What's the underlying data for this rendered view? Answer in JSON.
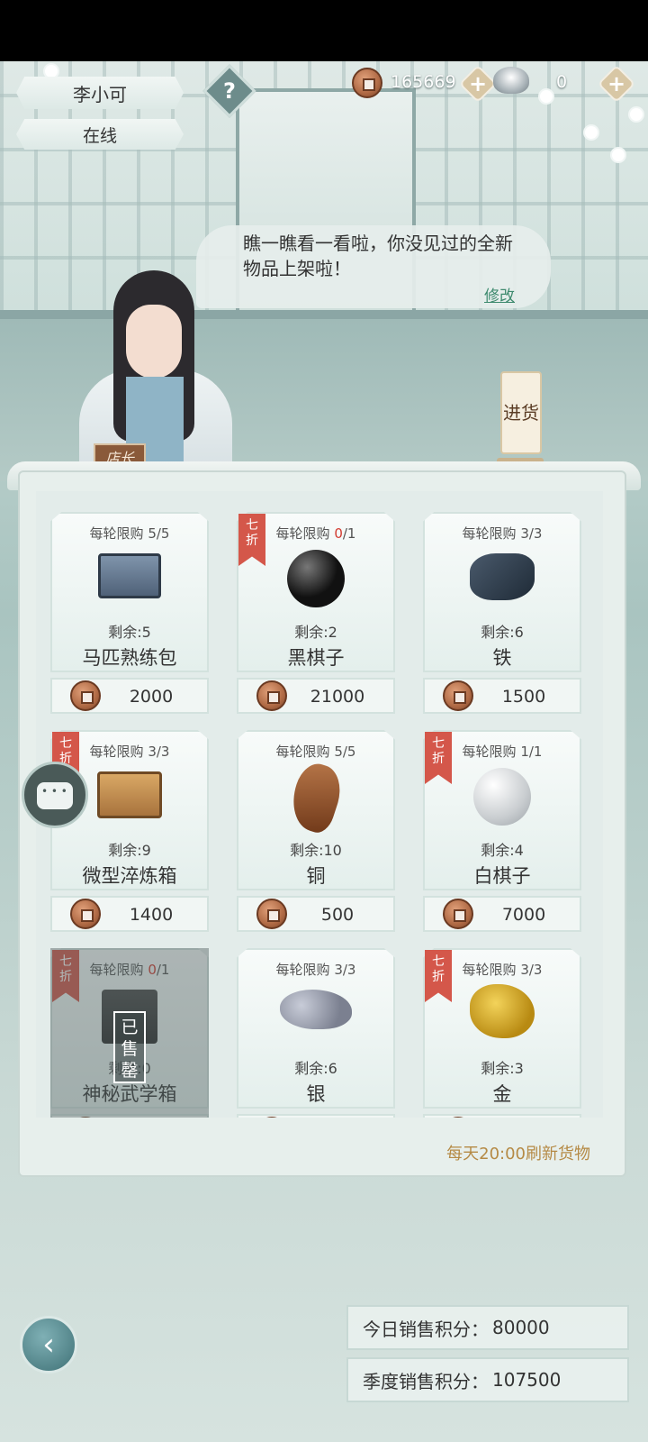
{
  "header": {
    "user_name": "李小可",
    "status": "在线",
    "help_icon": "question-icon",
    "copper_coins": "165669",
    "silver_ingots": "0"
  },
  "npc": {
    "speech": "瞧一瞧看一看啦，你没见过的全新物品上架啦！",
    "edit_label": "修改",
    "title_tag": "店长"
  },
  "restock": {
    "label": "进货"
  },
  "items": [
    {
      "limit_prefix": "每轮限购",
      "limit_used": "5",
      "limit_total": "/5",
      "used_red": false,
      "discount": "",
      "remain": "剩余:5",
      "name": "马匹熟练包",
      "price": "2000",
      "icon": "box-icon",
      "sold_out": false
    },
    {
      "limit_prefix": "每轮限购",
      "limit_used": "0",
      "limit_total": "/1",
      "used_red": true,
      "discount": "七折",
      "remain": "剩余:2",
      "name": "黑棋子",
      "price": "21000",
      "icon": "black-go-stone-icon",
      "sold_out": false
    },
    {
      "limit_prefix": "每轮限购",
      "limit_used": "3",
      "limit_total": "/3",
      "used_red": false,
      "discount": "",
      "remain": "剩余:6",
      "name": "铁",
      "price": "1500",
      "icon": "iron-ore-icon",
      "sold_out": false
    },
    {
      "limit_prefix": "每轮限购",
      "limit_used": "3",
      "limit_total": "/3",
      "used_red": false,
      "discount": "七折",
      "remain": "剩余:9",
      "name": "微型淬炼箱",
      "price": "1400",
      "icon": "chest-icon",
      "sold_out": false
    },
    {
      "limit_prefix": "每轮限购",
      "limit_used": "5",
      "limit_total": "/5",
      "used_red": false,
      "discount": "",
      "remain": "剩余:10",
      "name": "铜",
      "price": "500",
      "icon": "copper-ore-icon",
      "sold_out": false
    },
    {
      "limit_prefix": "每轮限购",
      "limit_used": "1",
      "limit_total": "/1",
      "used_red": false,
      "discount": "七折",
      "remain": "剩余:4",
      "name": "白棋子",
      "price": "7000",
      "icon": "white-go-stone-icon",
      "sold_out": false
    },
    {
      "limit_prefix": "每轮限购",
      "limit_used": "0",
      "limit_total": "/1",
      "used_red": true,
      "discount": "七折",
      "remain": "剩余:0",
      "name": "神秘武学箱",
      "price": "",
      "icon": "mystery-box-icon",
      "sold_out": true,
      "sold_out_label": "已售罄"
    },
    {
      "limit_prefix": "每轮限购",
      "limit_used": "3",
      "limit_total": "/3",
      "used_red": false,
      "discount": "",
      "remain": "剩余:6",
      "name": "银",
      "price": "",
      "icon": "silver-ore-icon",
      "sold_out": false
    },
    {
      "limit_prefix": "每轮限购",
      "limit_used": "3",
      "limit_total": "/3",
      "used_red": false,
      "discount": "七折",
      "remain": "剩余:3",
      "name": "金",
      "price": "",
      "icon": "gold-ore-icon",
      "sold_out": false
    }
  ],
  "refresh_note": "每天20:00刷新货物",
  "scores": {
    "today_label": "今日销售积分：",
    "today_value": "80000",
    "season_label": "季度销售积分：",
    "season_value": "107500"
  },
  "colors": {
    "accent": "#3e8a6e",
    "discount": "#d4574a",
    "note": "#b58a45"
  }
}
